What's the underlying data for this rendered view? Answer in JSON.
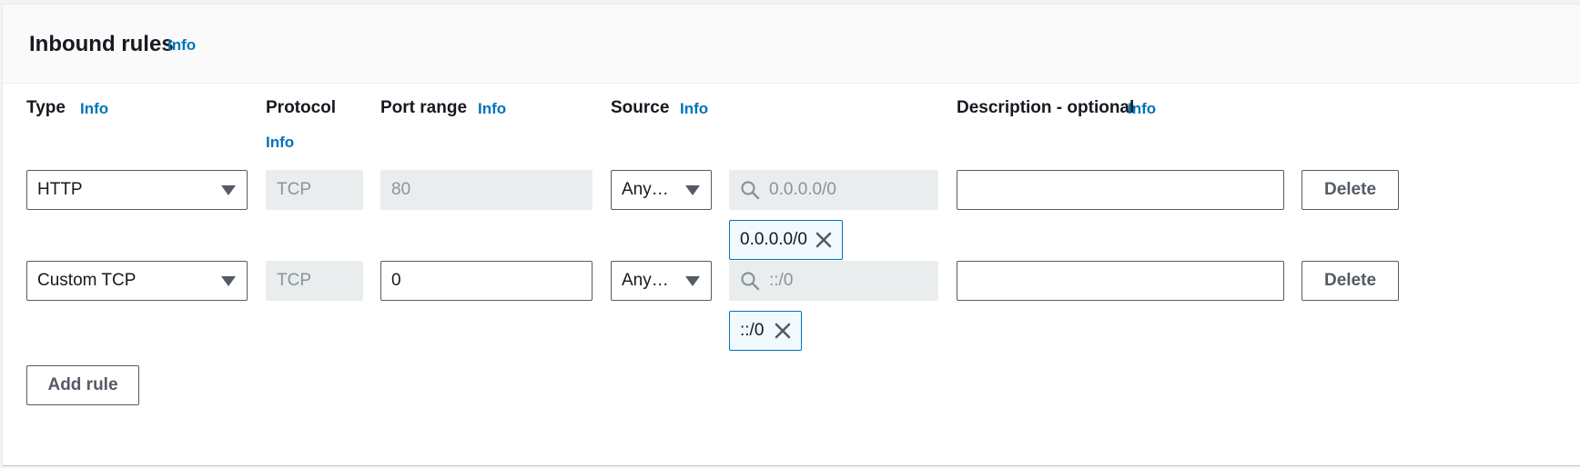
{
  "section": {
    "title": "Inbound rules",
    "info": "Info"
  },
  "columns": {
    "type": {
      "label": "Type",
      "info": "Info"
    },
    "protocol": {
      "label": "Protocol",
      "info": "Info"
    },
    "port_range": {
      "label": "Port range",
      "info": "Info"
    },
    "source": {
      "label": "Source",
      "info": "Info"
    },
    "description": {
      "label": "Description - optional",
      "info": "Info"
    }
  },
  "rules": [
    {
      "type": "HTTP",
      "protocol": "TCP",
      "port_range": "80",
      "source_type": "Any…",
      "source_search_placeholder": "0.0.0.0/0",
      "source_token": "0.0.0.0/0",
      "description": "",
      "delete_label": "Delete"
    },
    {
      "type": "Custom TCP",
      "protocol": "TCP",
      "port_range": "0",
      "source_type": "Any…",
      "source_search_placeholder": "::/0",
      "source_token": "::/0",
      "description": "",
      "delete_label": "Delete"
    }
  ],
  "actions": {
    "add_rule": "Add rule"
  },
  "icons": {
    "search": "search-icon",
    "remove": "close-icon",
    "dropdown": "caret-down-icon"
  },
  "colors": {
    "link": "#0073bb",
    "token_border": "#0073bb",
    "disabled_bg": "#eaeded"
  }
}
